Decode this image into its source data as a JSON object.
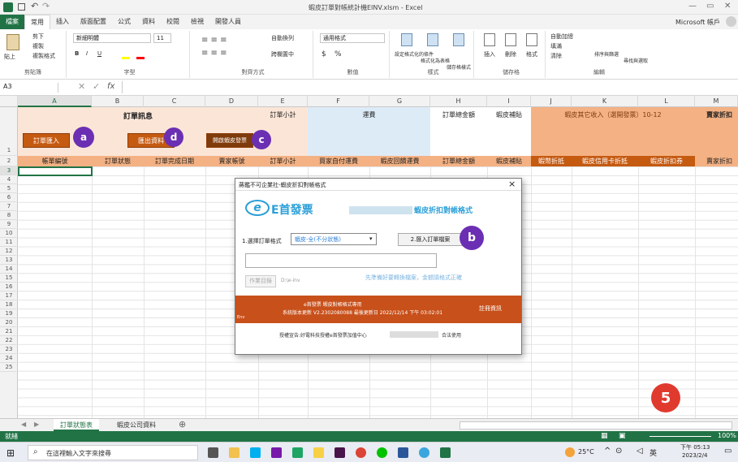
{
  "window": {
    "title": "蝦皮訂單對帳統計機EINV.xlsm - Excel",
    "account": "Microsoft 帳戶"
  },
  "ribbon_tabs": [
    "檔案",
    "常用",
    "插入",
    "版面配置",
    "公式",
    "資料",
    "校閱",
    "檢視",
    "開發人員"
  ],
  "ribbon": {
    "clipboard": {
      "paste": "貼上",
      "cut": "剪下",
      "copy": "複製",
      "format_painter": "複製格式",
      "label": "剪貼簿"
    },
    "font": {
      "name": "新細明體",
      "size": "11",
      "bold": "B",
      "italic": "I",
      "underline": "U",
      "label": "字型"
    },
    "alignment": {
      "wrap": "自動換列",
      "merge": "跨欄置中",
      "label": "對齊方式"
    },
    "number": {
      "format": "通用格式",
      "currency": "$",
      "percent": "%",
      "label": "數值"
    },
    "styles": {
      "conditional": "設定格式化的條件",
      "as_table": "格式化為表格",
      "cell_styles": "儲存格樣式",
      "label": "樣式"
    },
    "cells": {
      "insert": "插入",
      "delete": "刪除",
      "format": "格式",
      "label": "儲存格"
    },
    "editing": {
      "autosum": "自動加總",
      "fill": "填滿",
      "clear": "清除",
      "sort": "排序與篩選",
      "find": "尋找與選取",
      "label": "編輯"
    }
  },
  "formula_bar": {
    "cell_ref": "A3",
    "fx": "fx"
  },
  "columns": [
    "A",
    "B",
    "C",
    "D",
    "E",
    "F",
    "G",
    "H",
    "I",
    "J",
    "K",
    "L",
    "M"
  ],
  "rows": [
    "1",
    "2",
    "3",
    "4",
    "5",
    "6",
    "7",
    "8",
    "9",
    "10",
    "11",
    "12",
    "13",
    "14",
    "15",
    "16",
    "17",
    "18",
    "19",
    "20",
    "21",
    "22",
    "23",
    "24",
    "25"
  ],
  "row1": {
    "order_info": "訂單訊息",
    "order_subtotal": "訂單小計",
    "shipping": "運費",
    "order_total": "訂單總金額",
    "shopee_subsidy": "蝦皮補貼",
    "other_income": "蝦皮其它收入（選開發票）10-12",
    "seller_discount": "賣家折扣"
  },
  "row1_buttons": {
    "import": "訂單匯入",
    "export": "匯出資料",
    "clear": "開啟蝦皮發票"
  },
  "badges": {
    "a": "a",
    "b": "b",
    "c": "c",
    "d": "d",
    "five": "5"
  },
  "row2_headers": [
    "帳單編號",
    "訂單狀態",
    "訂單完成日期",
    "賣家帳號",
    "訂單小計",
    "買家自付運費",
    "蝦皮回饋運費",
    "訂單總金額",
    "蝦皮補貼",
    "蝦幣折抵",
    "蝦皮信用卡折抵",
    "蝦皮折扣券",
    "賣家折扣"
  ],
  "sheet_tabs": [
    "訂單狀態表",
    "蝦皮公司資料"
  ],
  "status": {
    "ready": "就緒",
    "zoom": "100%"
  },
  "dialog": {
    "title": "蔣鑑不可企業社-蝦皮折扣對帳格式",
    "close": "×",
    "logo_text": "E首發票",
    "logo_mark": "e",
    "subtitle": "蝦皮折扣對帳格式",
    "step1_label": "1.選擇訂單格式",
    "step1_value": "蝦皮-全(不分狀態)",
    "step2_button": "2.匯入訂單檔案",
    "path_value": "",
    "work_dir_button": "作業目錄",
    "work_dir_path": "D:\\e-inv",
    "hint": "先準備好要轉換檔案，金額請格式正確",
    "banner_line1": "e首發票 蝦皮對帳格式專用",
    "banner_line2": "系統版本更新 V2.2302080088 最後更新日 2022/12/14 下午 03:02:01",
    "banner_link": "註冊資訊",
    "banner_corner": "Env",
    "footer": "授權宣告:好電科技授權e首發票加值中心",
    "footer_tail": "合法使用"
  },
  "taskbar": {
    "search": "在這裡輸入文字來搜尋",
    "weather": "25°C",
    "ime": "英",
    "time": "下午 05:13",
    "date": "2023/2/4"
  },
  "colors": {
    "excel_green": "#217346",
    "orange": "#c55a11",
    "salmon": "#f4b183",
    "light_salmon": "#fbe5d6",
    "light_blue": "#ddebf7",
    "badge_purple": "#6b2fb3",
    "badge_red": "#e03a2f"
  }
}
